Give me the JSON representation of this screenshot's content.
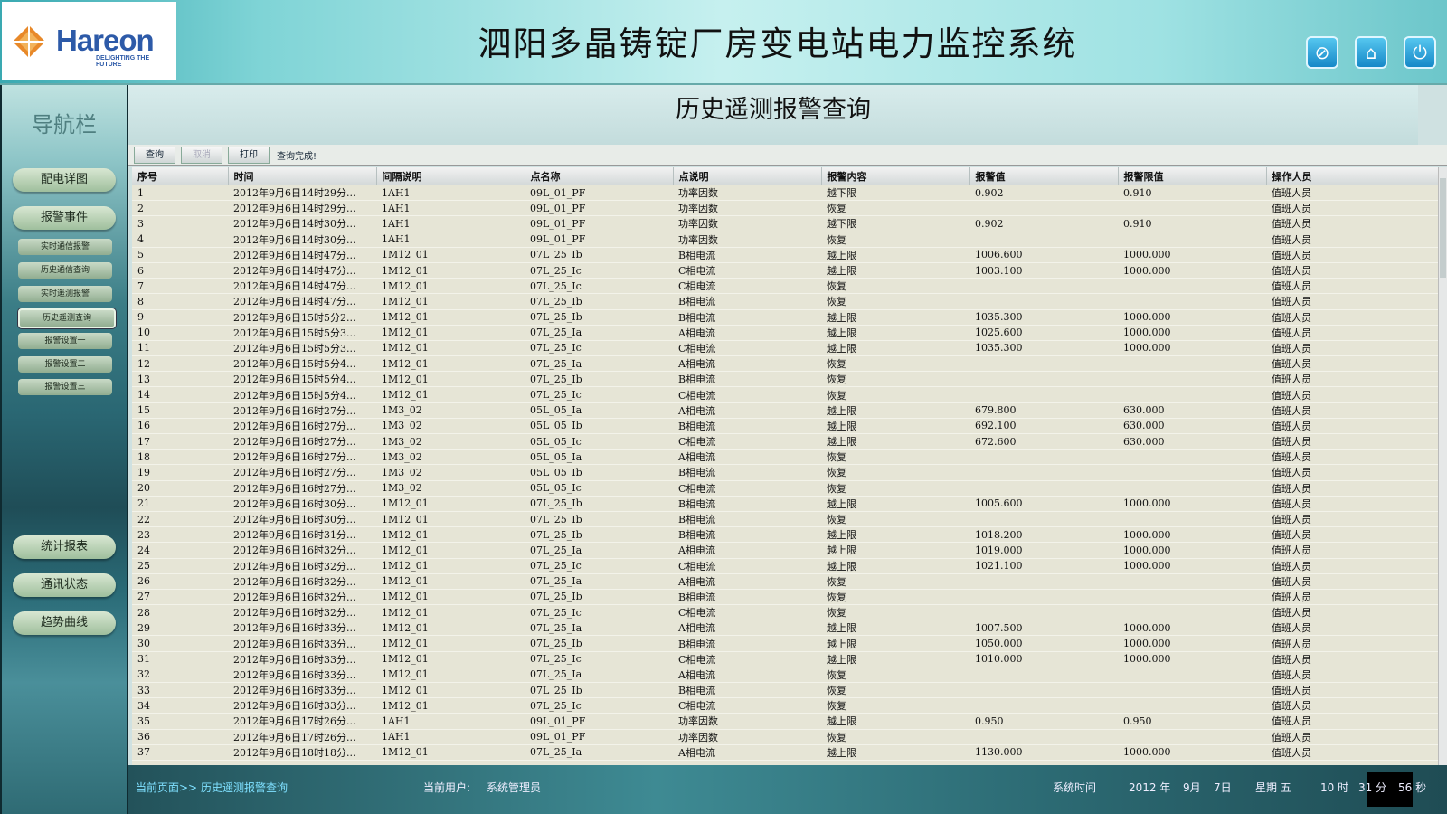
{
  "header": {
    "logo_text": "Hareon",
    "logo_sub": "DELIGHTING THE FUTURE",
    "title": "泗阳多晶铸锭厂房变电站电力监控系统",
    "icons": [
      "cancel-icon",
      "home-icon",
      "power-icon"
    ]
  },
  "sidebar": {
    "title": "导航栏",
    "main_buttons": [
      "配电详图",
      "报警事件"
    ],
    "sub_buttons": [
      "实时通信报警",
      "历史通信查询",
      "实时遥测报警",
      "历史遥测查询",
      "报警设置一",
      "报警设置二",
      "报警设置三"
    ],
    "active_sub": "历史遥测查询",
    "bottom_buttons": [
      "统计报表",
      "通讯状态",
      "趋势曲线"
    ]
  },
  "page": {
    "title": "历史遥测报警查询"
  },
  "toolbar": {
    "query_label": "查询",
    "cancel_label": "取消",
    "print_label": "打印",
    "status": "查询完成!"
  },
  "table": {
    "columns": [
      "序号",
      "时间",
      "间隔说明",
      "点名称",
      "点说明",
      "报警内容",
      "报警值",
      "报警限值",
      "操作人员"
    ],
    "rows": [
      [
        "1",
        "2012年9月6日14时29分...",
        "1AH1",
        "09L_01_PF",
        "功率因数",
        "越下限",
        "0.902",
        "0.910",
        "值班人员"
      ],
      [
        "2",
        "2012年9月6日14时29分...",
        "1AH1",
        "09L_01_PF",
        "功率因数",
        "恢复",
        "",
        "",
        "值班人员"
      ],
      [
        "3",
        "2012年9月6日14时30分...",
        "1AH1",
        "09L_01_PF",
        "功率因数",
        "越下限",
        "0.902",
        "0.910",
        "值班人员"
      ],
      [
        "4",
        "2012年9月6日14时30分...",
        "1AH1",
        "09L_01_PF",
        "功率因数",
        "恢复",
        "",
        "",
        "值班人员"
      ],
      [
        "5",
        "2012年9月6日14时47分...",
        "1M12_01",
        "07L_25_Ib",
        "B相电流",
        "越上限",
        "1006.600",
        "1000.000",
        "值班人员"
      ],
      [
        "6",
        "2012年9月6日14时47分...",
        "1M12_01",
        "07L_25_Ic",
        "C相电流",
        "越上限",
        "1003.100",
        "1000.000",
        "值班人员"
      ],
      [
        "7",
        "2012年9月6日14时47分...",
        "1M12_01",
        "07L_25_Ic",
        "C相电流",
        "恢复",
        "",
        "",
        "值班人员"
      ],
      [
        "8",
        "2012年9月6日14时47分...",
        "1M12_01",
        "07L_25_Ib",
        "B相电流",
        "恢复",
        "",
        "",
        "值班人员"
      ],
      [
        "9",
        "2012年9月6日15时5分2...",
        "1M12_01",
        "07L_25_Ib",
        "B相电流",
        "越上限",
        "1035.300",
        "1000.000",
        "值班人员"
      ],
      [
        "10",
        "2012年9月6日15时5分3...",
        "1M12_01",
        "07L_25_Ia",
        "A相电流",
        "越上限",
        "1025.600",
        "1000.000",
        "值班人员"
      ],
      [
        "11",
        "2012年9月6日15时5分3...",
        "1M12_01",
        "07L_25_Ic",
        "C相电流",
        "越上限",
        "1035.300",
        "1000.000",
        "值班人员"
      ],
      [
        "12",
        "2012年9月6日15时5分4...",
        "1M12_01",
        "07L_25_Ia",
        "A相电流",
        "恢复",
        "",
        "",
        "值班人员"
      ],
      [
        "13",
        "2012年9月6日15时5分4...",
        "1M12_01",
        "07L_25_Ib",
        "B相电流",
        "恢复",
        "",
        "",
        "值班人员"
      ],
      [
        "14",
        "2012年9月6日15时5分4...",
        "1M12_01",
        "07L_25_Ic",
        "C相电流",
        "恢复",
        "",
        "",
        "值班人员"
      ],
      [
        "15",
        "2012年9月6日16时27分...",
        "1M3_02",
        "05L_05_Ia",
        "A相电流",
        "越上限",
        "679.800",
        "630.000",
        "值班人员"
      ],
      [
        "16",
        "2012年9月6日16时27分...",
        "1M3_02",
        "05L_05_Ib",
        "B相电流",
        "越上限",
        "692.100",
        "630.000",
        "值班人员"
      ],
      [
        "17",
        "2012年9月6日16时27分...",
        "1M3_02",
        "05L_05_Ic",
        "C相电流",
        "越上限",
        "672.600",
        "630.000",
        "值班人员"
      ],
      [
        "18",
        "2012年9月6日16时27分...",
        "1M3_02",
        "05L_05_Ia",
        "A相电流",
        "恢复",
        "",
        "",
        "值班人员"
      ],
      [
        "19",
        "2012年9月6日16时27分...",
        "1M3_02",
        "05L_05_Ib",
        "B相电流",
        "恢复",
        "",
        "",
        "值班人员"
      ],
      [
        "20",
        "2012年9月6日16时27分...",
        "1M3_02",
        "05L_05_Ic",
        "C相电流",
        "恢复",
        "",
        "",
        "值班人员"
      ],
      [
        "21",
        "2012年9月6日16时30分...",
        "1M12_01",
        "07L_25_Ib",
        "B相电流",
        "越上限",
        "1005.600",
        "1000.000",
        "值班人员"
      ],
      [
        "22",
        "2012年9月6日16时30分...",
        "1M12_01",
        "07L_25_Ib",
        "B相电流",
        "恢复",
        "",
        "",
        "值班人员"
      ],
      [
        "23",
        "2012年9月6日16时31分...",
        "1M12_01",
        "07L_25_Ib",
        "B相电流",
        "越上限",
        "1018.200",
        "1000.000",
        "值班人员"
      ],
      [
        "24",
        "2012年9月6日16时32分...",
        "1M12_01",
        "07L_25_Ia",
        "A相电流",
        "越上限",
        "1019.000",
        "1000.000",
        "值班人员"
      ],
      [
        "25",
        "2012年9月6日16时32分...",
        "1M12_01",
        "07L_25_Ic",
        "C相电流",
        "越上限",
        "1021.100",
        "1000.000",
        "值班人员"
      ],
      [
        "26",
        "2012年9月6日16时32分...",
        "1M12_01",
        "07L_25_Ia",
        "A相电流",
        "恢复",
        "",
        "",
        "值班人员"
      ],
      [
        "27",
        "2012年9月6日16时32分...",
        "1M12_01",
        "07L_25_Ib",
        "B相电流",
        "恢复",
        "",
        "",
        "值班人员"
      ],
      [
        "28",
        "2012年9月6日16时32分...",
        "1M12_01",
        "07L_25_Ic",
        "C相电流",
        "恢复",
        "",
        "",
        "值班人员"
      ],
      [
        "29",
        "2012年9月6日16时33分...",
        "1M12_01",
        "07L_25_Ia",
        "A相电流",
        "越上限",
        "1007.500",
        "1000.000",
        "值班人员"
      ],
      [
        "30",
        "2012年9月6日16时33分...",
        "1M12_01",
        "07L_25_Ib",
        "B相电流",
        "越上限",
        "1050.000",
        "1000.000",
        "值班人员"
      ],
      [
        "31",
        "2012年9月6日16时33分...",
        "1M12_01",
        "07L_25_Ic",
        "C相电流",
        "越上限",
        "1010.000",
        "1000.000",
        "值班人员"
      ],
      [
        "32",
        "2012年9月6日16时33分...",
        "1M12_01",
        "07L_25_Ia",
        "A相电流",
        "恢复",
        "",
        "",
        "值班人员"
      ],
      [
        "33",
        "2012年9月6日16时33分...",
        "1M12_01",
        "07L_25_Ib",
        "B相电流",
        "恢复",
        "",
        "",
        "值班人员"
      ],
      [
        "34",
        "2012年9月6日16时33分...",
        "1M12_01",
        "07L_25_Ic",
        "C相电流",
        "恢复",
        "",
        "",
        "值班人员"
      ],
      [
        "35",
        "2012年9月6日17时26分...",
        "1AH1",
        "09L_01_PF",
        "功率因数",
        "越上限",
        "0.950",
        "0.950",
        "值班人员"
      ],
      [
        "36",
        "2012年9月6日17时26分...",
        "1AH1",
        "09L_01_PF",
        "功率因数",
        "恢复",
        "",
        "",
        "值班人员"
      ],
      [
        "37",
        "2012年9月6日18时18分...",
        "1M12_01",
        "07L_25_Ia",
        "A相电流",
        "越上限",
        "1130.000",
        "1000.000",
        "值班人员"
      ]
    ]
  },
  "footer": {
    "current_page_label": "当前页面>>",
    "current_page": "历史遥测报警查询",
    "user_label": "当前用户:",
    "user": "系统管理员",
    "time_label": "系统时间",
    "year": "2012 年",
    "month": "9月",
    "day": "7日",
    "weekday": "星期 五",
    "hour": "10 时",
    "minute": "31 分",
    "second": "56 秒"
  }
}
